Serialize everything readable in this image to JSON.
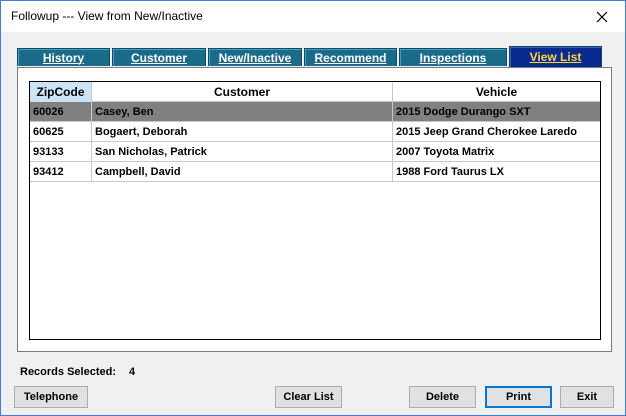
{
  "window": {
    "title": "Followup --- View from New/Inactive",
    "close_symbol": "close-icon"
  },
  "tabs": [
    {
      "label": "History",
      "active": false
    },
    {
      "label": "Customer",
      "active": false
    },
    {
      "label": "New/Inactive",
      "active": false
    },
    {
      "label": "Recommend",
      "active": false
    },
    {
      "label": "Inspections",
      "active": false
    },
    {
      "label": "View List",
      "active": true
    }
  ],
  "grid": {
    "columns": [
      "ZipCode",
      "Customer",
      "Vehicle"
    ],
    "rows": [
      {
        "zip": "60026",
        "customer": "Casey, Ben",
        "vehicle": "2015 Dodge Durango SXT",
        "selected": true
      },
      {
        "zip": "60625",
        "customer": "Bogaert, Deborah",
        "vehicle": "2015 Jeep Grand Cherokee Laredo",
        "selected": false
      },
      {
        "zip": "93133",
        "customer": "San Nicholas, Patrick",
        "vehicle": "2007 Toyota Matrix",
        "selected": false
      },
      {
        "zip": "93412",
        "customer": "Campbell, David",
        "vehicle": "1988 Ford Taurus LX",
        "selected": false
      }
    ]
  },
  "records": {
    "label": "Records Selected:",
    "count": "4"
  },
  "buttons": {
    "telephone": "Telephone",
    "clear_list": "Clear List",
    "delete": "Delete",
    "print": "Print",
    "exit": "Exit"
  },
  "colors": {
    "tab_bg": "#1a6b8a",
    "tab_active_bg": "#0a2a8f",
    "tab_active_text": "#ffd83a",
    "selected_row": "#808080",
    "header_highlight": "#cce4f7"
  }
}
